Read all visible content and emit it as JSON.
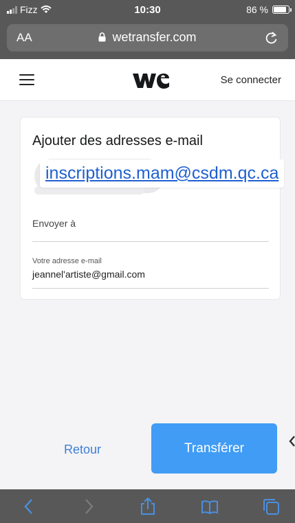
{
  "status_bar": {
    "carrier": "Fizz",
    "time": "10:30",
    "battery": "86 %"
  },
  "browser": {
    "text_size_label": "AA",
    "url": "wetransfer.com"
  },
  "header": {
    "login_label": "Se connecter"
  },
  "form": {
    "title": "Ajouter des adresses e-mail",
    "recipient_tooltip": "inscriptions.mam@csdm.qc.ca",
    "send_to_placeholder": "Envoyer à",
    "sender_label": "Votre adresse e-mail",
    "sender_value": "jeannel'artiste@gmail.com"
  },
  "actions": {
    "back_label": "Retour",
    "transfer_label": "Transférer"
  },
  "colors": {
    "chrome_bg": "#585858",
    "accent_blue": "#409cf5",
    "link_blue": "#3d7fd6",
    "tooltip_blue": "#1e5fd0"
  },
  "icons": {
    "status": [
      "signal-bars-icon",
      "wifi-icon",
      "battery-icon"
    ],
    "browser": [
      "lock-icon",
      "reload-icon"
    ],
    "toolbar": [
      "back-arrow-icon",
      "forward-arrow-icon",
      "share-icon",
      "bookmarks-icon",
      "tabs-icon"
    ]
  }
}
